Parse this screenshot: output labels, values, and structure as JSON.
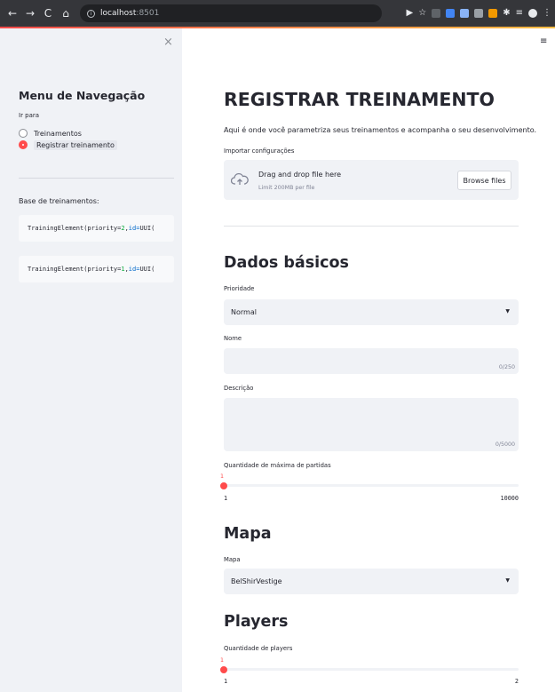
{
  "browser": {
    "back": "←",
    "forward": "→",
    "reload": "C",
    "home": "⌂",
    "url_host": "localhost",
    "url_port": ":8501"
  },
  "sidebar": {
    "close": "×",
    "title": "Menu de Navegação",
    "goto_label": "Ir para",
    "options": [
      {
        "label": "Treinamentos",
        "selected": false
      },
      {
        "label": "Registrar treinamento",
        "selected": true
      }
    ],
    "base_label": "Base de treinamentos:",
    "elements": [
      {
        "prefix": "TrainingElement(priority=",
        "priority": "2",
        "sep": ", ",
        "id_kw": "id=",
        "id_rest": "UUI("
      },
      {
        "prefix": "TrainingElement(priority=",
        "priority": "1",
        "sep": ", ",
        "id_kw": "id=",
        "id_rest": "UUI("
      }
    ]
  },
  "main": {
    "menu": "≡",
    "title": "REGISTRAR TREINAMENTO",
    "description": "Aqui é onde você parametriza seus treinamentos e acompanha o seu desenvolvimento.",
    "import_label": "Importar configurações",
    "uploader": {
      "main_text": "Drag and drop file here",
      "limit_text": "Limit 200MB per file",
      "browse": "Browse files"
    },
    "basic": {
      "heading": "Dados básicos",
      "priority_label": "Prioridade",
      "priority_value": "Normal",
      "name_label": "Nome",
      "name_counter": "0/250",
      "desc_label": "Descrição",
      "desc_counter": "0/5000",
      "max_matches_label": "Quantidade de máxima de partidas",
      "max_matches_value": "1",
      "max_matches_min": "1",
      "max_matches_max": "10000"
    },
    "map": {
      "heading": "Mapa",
      "label": "Mapa",
      "value": "BelShirVestige"
    },
    "players": {
      "heading": "Players",
      "label": "Quantidade de players",
      "value": "1",
      "min": "1",
      "max": "2"
    }
  },
  "colors": {
    "accent": "#ff4b4b",
    "sidebar_bg": "#f0f2f6",
    "chrome_bg": "#35363a"
  }
}
